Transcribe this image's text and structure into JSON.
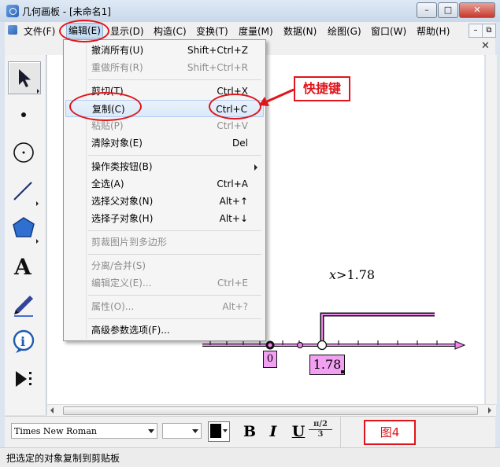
{
  "window": {
    "title": "几何画板 - [未命名1]",
    "minimize": "–",
    "maximize": "□",
    "close": "✕"
  },
  "menubar": {
    "items": [
      "文件(F)",
      "编辑(E)",
      "显示(D)",
      "构造(C)",
      "变换(T)",
      "度量(M)",
      "数据(N)",
      "绘图(G)",
      "窗口(W)",
      "帮助(H)"
    ],
    "active_index": 1,
    "mdi_minimize": "–",
    "mdi_restore": "⧉",
    "doc_close": "✕"
  },
  "edit_menu": {
    "items": [
      {
        "label": "撤消所有(U)",
        "shortcut": "Shift+Ctrl+Z",
        "enabled": true
      },
      {
        "label": "重做所有(R)",
        "shortcut": "Shift+Ctrl+R",
        "enabled": false
      },
      {
        "label": "剪切(T)",
        "shortcut": "Ctrl+X",
        "enabled": true
      },
      {
        "label": "复制(C)",
        "shortcut": "Ctrl+C",
        "enabled": true,
        "highlighted": true
      },
      {
        "label": "粘贴(P)",
        "shortcut": "Ctrl+V",
        "enabled": false
      },
      {
        "label": "清除对象(E)",
        "shortcut": "Del",
        "enabled": true
      },
      {
        "label": "操作类按钮(B)",
        "shortcut": "",
        "enabled": true,
        "submenu": true
      },
      {
        "label": "全选(A)",
        "shortcut": "Ctrl+A",
        "enabled": true
      },
      {
        "label": "选择父对象(N)",
        "shortcut": "Alt+↑",
        "enabled": true
      },
      {
        "label": "选择子对象(H)",
        "shortcut": "Alt+↓",
        "enabled": true
      },
      {
        "label": "剪裁图片到多边形",
        "shortcut": "",
        "enabled": false
      },
      {
        "label": "分离/合并(S)",
        "shortcut": "",
        "enabled": false
      },
      {
        "label": "编辑定义(E)...",
        "shortcut": "Ctrl+E",
        "enabled": false
      },
      {
        "label": "属性(O)...",
        "shortcut": "Alt+?",
        "enabled": false
      },
      {
        "label": "高级参数选项(F)...",
        "shortcut": "",
        "enabled": true
      }
    ]
  },
  "annotation": {
    "callout": "快捷键"
  },
  "toolbar": {
    "tools": [
      "arrow-select",
      "point",
      "compass",
      "straightedge",
      "polygon",
      "text",
      "marker",
      "information",
      "custom"
    ]
  },
  "canvas": {
    "inequality_var": "x",
    "inequality_rest": ">1.78",
    "origin_label": "0",
    "value_label": "1.78"
  },
  "formatbar": {
    "font": "Times New Roman",
    "font_size": "",
    "bold": "B",
    "italic": "I",
    "underline": "U",
    "math_top": "π/2",
    "math_bottom": "3",
    "figure_label": "图4"
  },
  "status": {
    "text": "把选定的对象复制到剪贴板"
  },
  "colors": {
    "accent_red": "#e0151b",
    "number_line": "#ee88ee",
    "label_fill": "#f2a0f2"
  }
}
